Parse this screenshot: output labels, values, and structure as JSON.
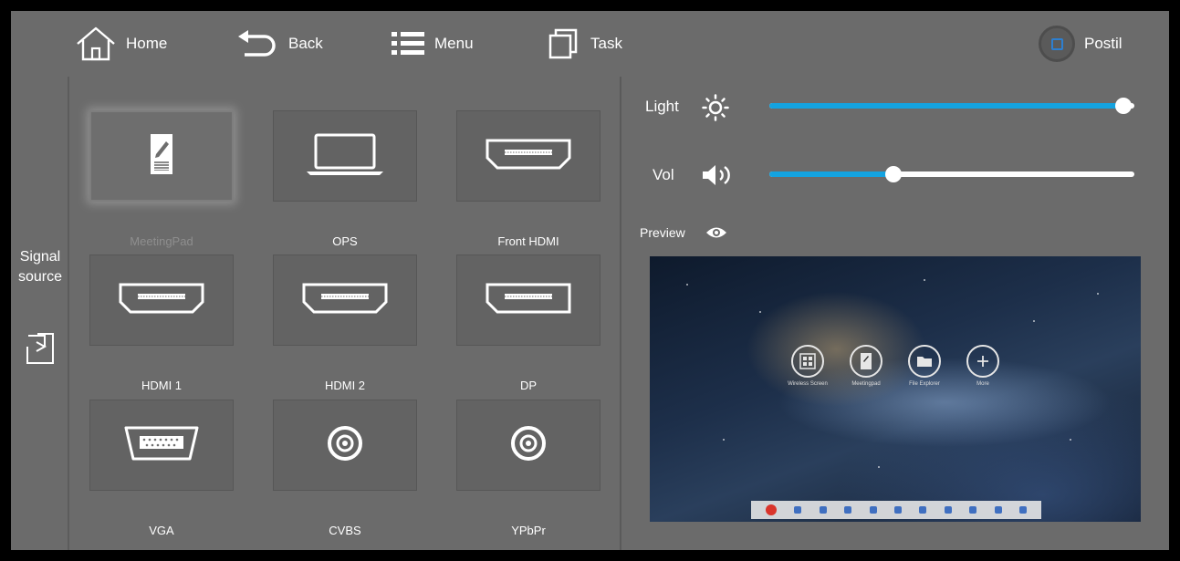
{
  "topbar": {
    "home_label": "Home",
    "back_label": "Back",
    "menu_label": "Menu",
    "task_label": "Task",
    "postil_label": "Postil"
  },
  "sidebar": {
    "signal_source_line1": "Signal",
    "signal_source_line2": "source"
  },
  "sources": [
    {
      "label": "MeetingPad",
      "icon": "meetingpad-icon",
      "selected": true
    },
    {
      "label": "OPS",
      "icon": "laptop-icon",
      "selected": false
    },
    {
      "label": "Front HDMI",
      "icon": "hdmi-port-icon",
      "selected": false
    },
    {
      "label": "HDMI 1",
      "icon": "hdmi-port-icon",
      "selected": false
    },
    {
      "label": "HDMI 2",
      "icon": "hdmi-port-icon",
      "selected": false
    },
    {
      "label": "DP",
      "icon": "displayport-icon",
      "selected": false
    },
    {
      "label": "VGA",
      "icon": "vga-port-icon",
      "selected": false
    },
    {
      "label": "CVBS",
      "icon": "rca-port-icon",
      "selected": false
    },
    {
      "label": "YPbPr",
      "icon": "rca-port-icon",
      "selected": false
    }
  ],
  "controls": {
    "light_label": "Light",
    "light_level": 0.97,
    "vol_label": "Vol",
    "vol_level": 0.34,
    "preview_label": "Preview"
  },
  "preview_screen": {
    "apps": [
      {
        "label": "Wireless Screen"
      },
      {
        "label": "Meetingpad"
      },
      {
        "label": "File Explorer"
      },
      {
        "label": "More"
      }
    ]
  },
  "colors": {
    "accent": "#14a3e0",
    "background": "#6b6b6b",
    "postil_accent": "#2d7fd0"
  }
}
